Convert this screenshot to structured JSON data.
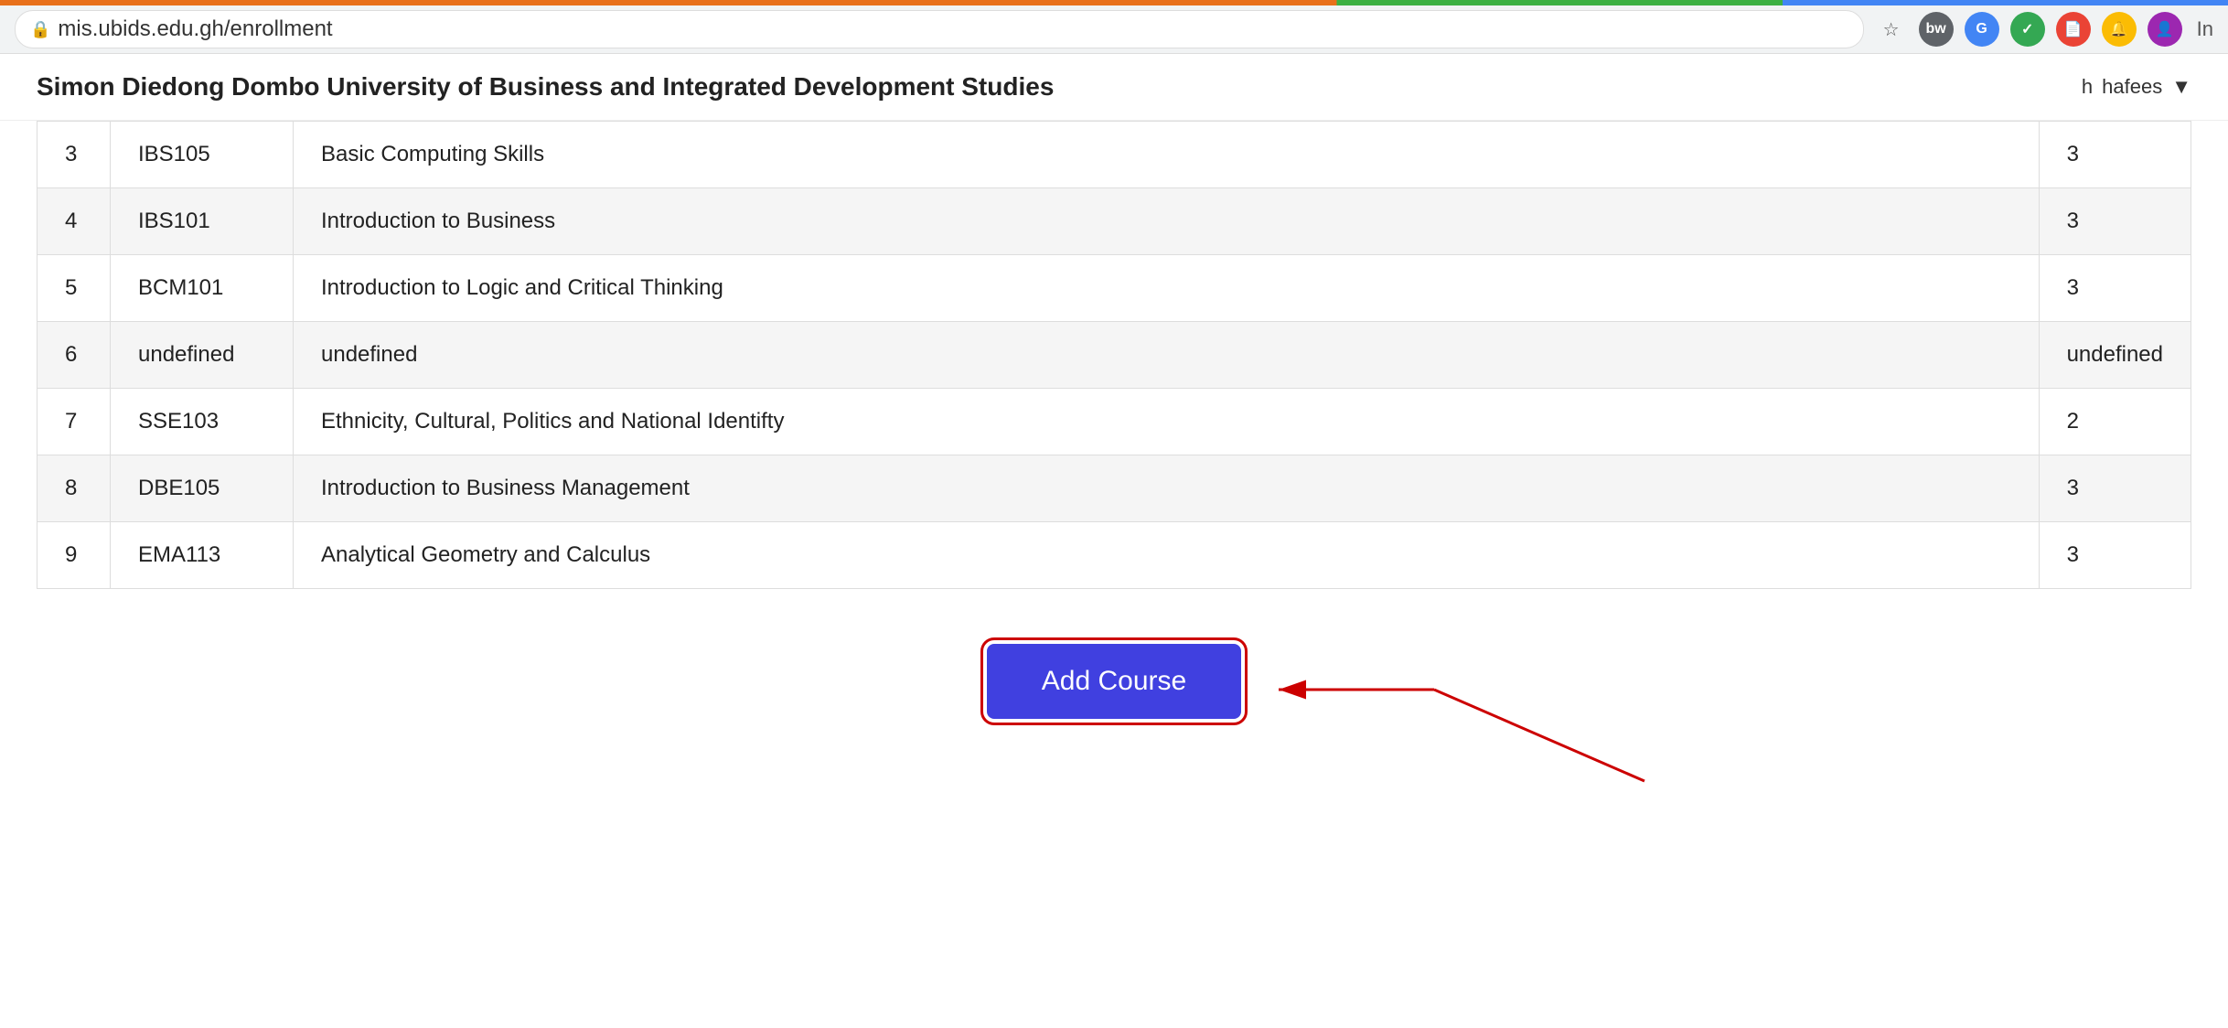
{
  "browser": {
    "url": "mis.ubids.edu.gh/enrollment",
    "lock_icon": "🔒",
    "extensions": [
      {
        "id": "bw",
        "label": "bw",
        "color": "#5f6368"
      },
      {
        "id": "g",
        "label": "G",
        "color": "#4285f4"
      },
      {
        "id": "check",
        "label": "✓",
        "color": "#34a853"
      },
      {
        "id": "doc",
        "label": "📄",
        "color": "#ea4335"
      },
      {
        "id": "bell",
        "label": "🔔",
        "color": "#fbbc04"
      },
      {
        "id": "face",
        "label": "👤",
        "color": "#9c27b0"
      }
    ],
    "star_icon": "☆"
  },
  "header": {
    "title": "Simon Diedong Dombo University of Business and Integrated Development Studies",
    "user_initial": "h",
    "user_name": "hafees",
    "dropdown_icon": "▼"
  },
  "table": {
    "rows": [
      {
        "num": "3",
        "code": "IBS105",
        "name": "Basic Computing Skills",
        "credits": "3",
        "highlighted": false
      },
      {
        "num": "4",
        "code": "IBS101",
        "name": "Introduction to Business",
        "credits": "3",
        "highlighted": true
      },
      {
        "num": "5",
        "code": "BCM101",
        "name": "Introduction to Logic and Critical Thinking",
        "credits": "3",
        "highlighted": false
      },
      {
        "num": "6",
        "code": "undefined",
        "name": "undefined",
        "credits": "undefined",
        "highlighted": true
      },
      {
        "num": "7",
        "code": "SSE103",
        "name": "Ethnicity, Cultural, Politics and National Identifty",
        "credits": "2",
        "highlighted": false
      },
      {
        "num": "8",
        "code": "DBE105",
        "name": "Introduction to Business Management",
        "credits": "3",
        "highlighted": true
      },
      {
        "num": "9",
        "code": "EMA113",
        "name": "Analytical Geometry and Calculus",
        "credits": "3",
        "highlighted": false
      }
    ]
  },
  "button": {
    "label": "Add Course"
  },
  "colors": {
    "accent_orange": "#e8701a",
    "accent_green": "#3cb043",
    "button_blue": "#4040e0",
    "arrow_red": "#cc0000",
    "outline_red": "#cc0000"
  }
}
